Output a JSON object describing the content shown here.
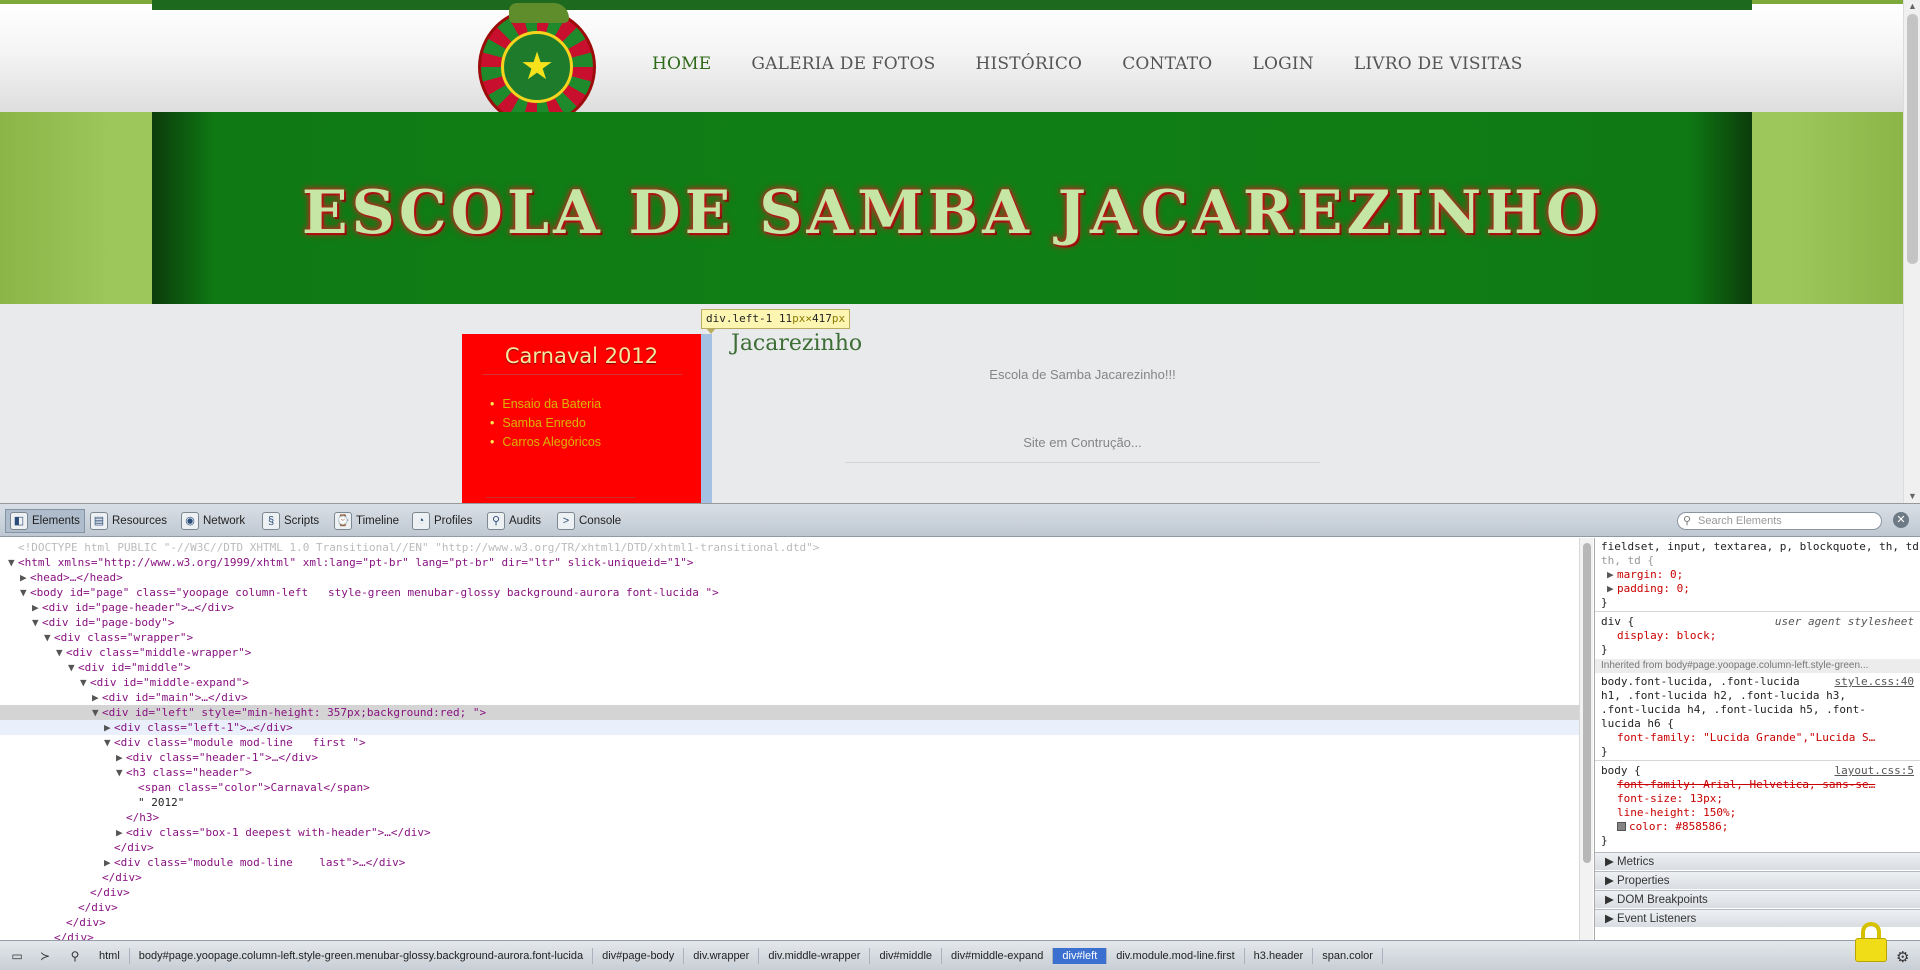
{
  "site": {
    "nav": [
      "HOME",
      "GALERIA DE FOTOS",
      "HISTÓRICO",
      "CONTATO",
      "LOGIN",
      "LIVRO DE VISITAS"
    ],
    "banner_title": "ESCOLA DE SAMBA JACAREZINHO",
    "sidebar": {
      "title": "Carnaval 2012",
      "items": [
        "Ensaio da Bateria",
        "Samba Enredo",
        "Carros Alegóricos"
      ]
    },
    "main": {
      "heading": "Jacarezinho",
      "paragraph1": "Escola de Samba Jacarezinho!!!",
      "paragraph2": "Site em Contrução..."
    },
    "tooltip": {
      "selector": "div.left-1",
      "w": "11",
      "unit1": "px",
      "x": "×",
      "h": "417",
      "unit2": "px"
    }
  },
  "devtools": {
    "tabs": [
      "Elements",
      "Resources",
      "Network",
      "Scripts",
      "Timeline",
      "Profiles",
      "Audits",
      "Console"
    ],
    "search_placeholder": "Search Elements",
    "dom_lines": [
      "<!DOCTYPE html PUBLIC \"-//W3C//DTD XHTML 1.0 Transitional//EN\" \"http://www.w3.org/TR/xhtml1/DTD/xhtml1-transitional.dtd\">",
      "<html xmlns=\"http://www.w3.org/1999/xhtml\" xml:lang=\"pt-br\" lang=\"pt-br\" dir=\"ltr\" slick-uniqueid=\"1\">",
      "<head>…</head>",
      "<body id=\"page\" class=\"yoopage column-left   style-green menubar-glossy background-aurora font-lucida \">",
      "<div id=\"page-header\">…</div>",
      "<div id=\"page-body\">",
      "<div class=\"wrapper\">",
      "<div class=\"middle-wrapper\">",
      "<div id=\"middle\">",
      "<div id=\"middle-expand\">",
      "<div id=\"main\">…</div>",
      "<div id=\"left\" style=\"min-height: 357px;background:red; \">",
      "<div class=\"left-1\">…</div>",
      "<div class=\"module mod-line   first \">",
      "<div class=\"header-1\">…</div>",
      "<h3 class=\"header\">",
      "<span class=\"color\">Carnaval</span>",
      "\" 2012\"",
      "</h3>",
      "<div class=\"box-1 deepest with-header\">…</div>",
      "</div>",
      "<div class=\"module mod-line    last\">…</div>",
      "</div>",
      "</div>",
      "</div>",
      "</div>",
      "</div>"
    ],
    "styles": {
      "rule1_selector": "fieldset, input, textarea, p, blockquote, th, td {",
      "rule1_props": [
        "margin: 0;",
        "padding: 0;"
      ],
      "rule2_selector": "div {",
      "rule2_source": "user agent stylesheet",
      "rule2_props": [
        "display: block;"
      ],
      "inherited": "Inherited from body#page.yoopage.column-left.style-green...",
      "rule3_selector_lines": [
        "body.font-lucida, .font-lucida",
        "h1, .font-lucida h2, .font-lucida h3,",
        ".font-lucida h4, .font-lucida h5, .font-",
        "lucida h6 {"
      ],
      "rule3_source": "style.css:40",
      "rule3_props": [
        "font-family: \"Lucida Grande\",\"Lucida S…"
      ],
      "rule4_selector": "body {",
      "rule4_source": "layout.css:5",
      "rule4_props": [
        "font-family: Arial, Helvetica, sans-se…",
        "font-size: 13px;",
        "line-height: 150%;",
        "color: #858586;"
      ],
      "close_brace": "}",
      "sections": [
        "Metrics",
        "Properties",
        "DOM Breakpoints",
        "Event Listeners"
      ]
    },
    "breadcrumbs": [
      "html",
      "body#page.yoopage.column-left.style-green.menubar-glossy.background-aurora.font-lucida",
      "div#page-body",
      "div.wrapper",
      "div.middle-wrapper",
      "div#middle",
      "div#middle-expand",
      "div#left",
      "div.module.mod-line.first",
      "h3.header",
      "span.color"
    ],
    "active_crumb": "div#left"
  }
}
